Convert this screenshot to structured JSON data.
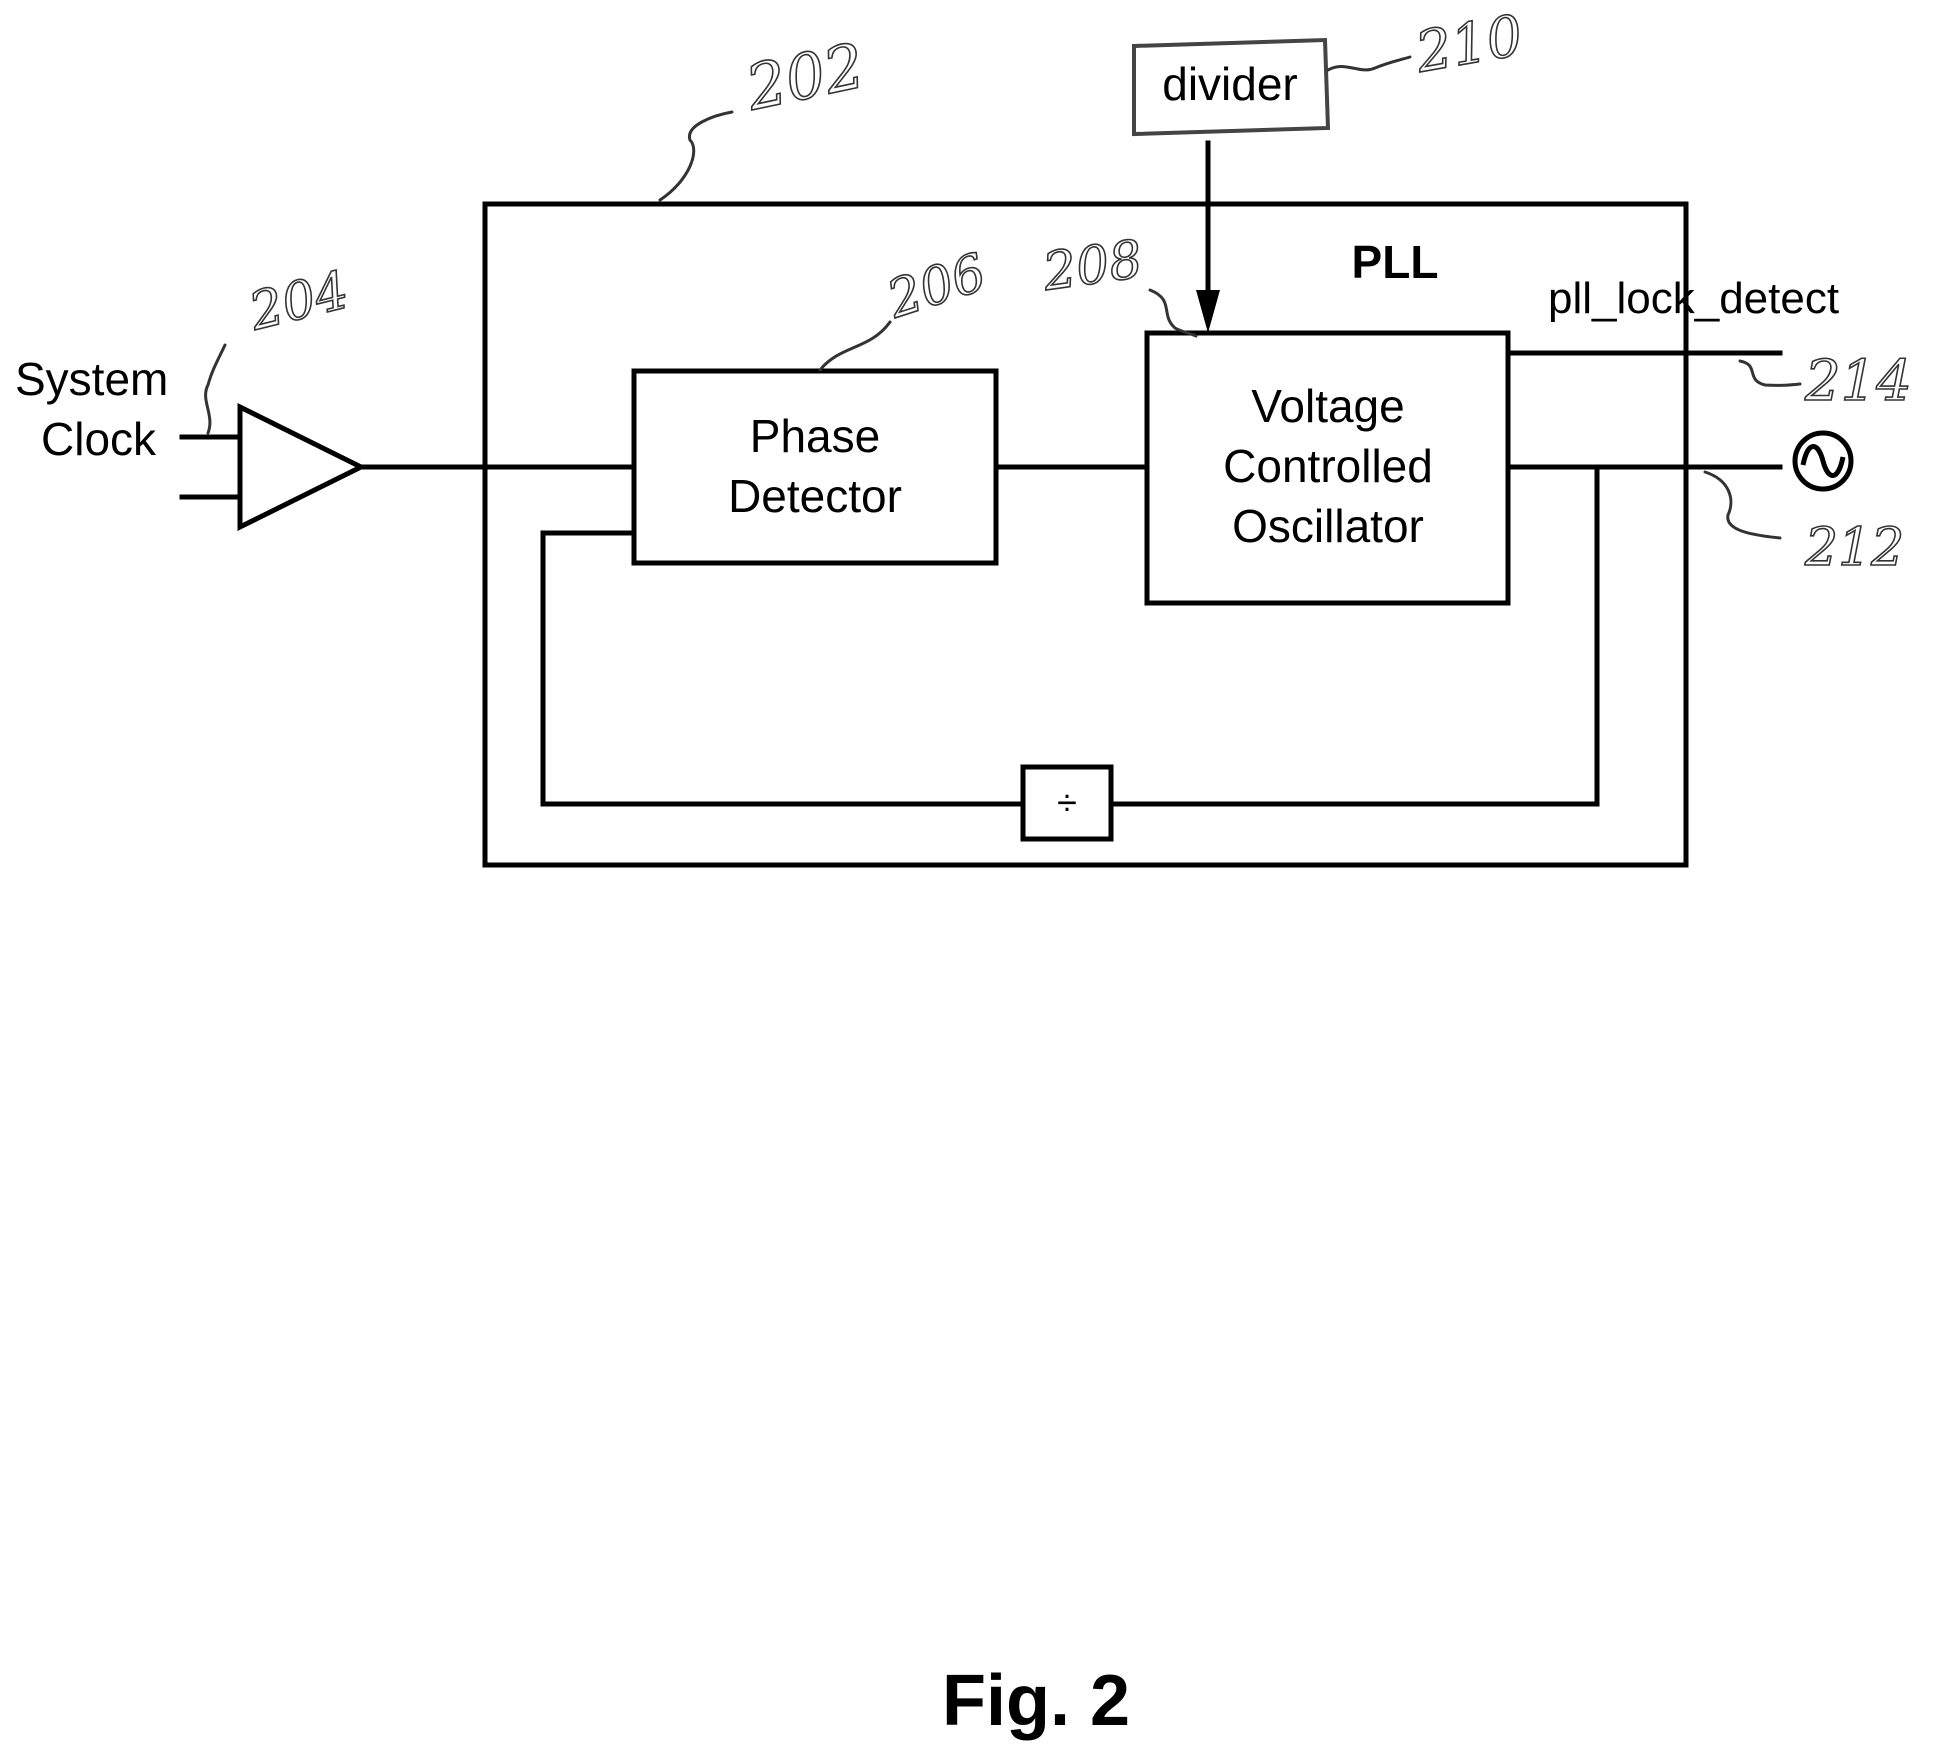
{
  "figure": {
    "caption": "Fig. 2",
    "pll_title": "PLL"
  },
  "blocks": {
    "system_clock": {
      "line1": "System",
      "line2": "Clock"
    },
    "phase_detector": {
      "line1": "Phase",
      "line2": "Detector"
    },
    "vco": {
      "line1": "Voltage",
      "line2": "Controlled",
      "line3": "Oscillator"
    },
    "divider": {
      "label": "divider"
    },
    "feedback_divider": {
      "symbol": "÷"
    }
  },
  "signals": {
    "lock_detect": "pll_lock_detect",
    "output_icon": "sine-wave-source"
  },
  "reference_numerals": {
    "pll": "202",
    "buffer": "204",
    "phase_detector": "206",
    "vco": "208",
    "divider": "210",
    "output": "212",
    "lock_detect": "214"
  },
  "colors": {
    "ink": "#000000",
    "handwriting": "#333333",
    "background": "#ffffff"
  }
}
